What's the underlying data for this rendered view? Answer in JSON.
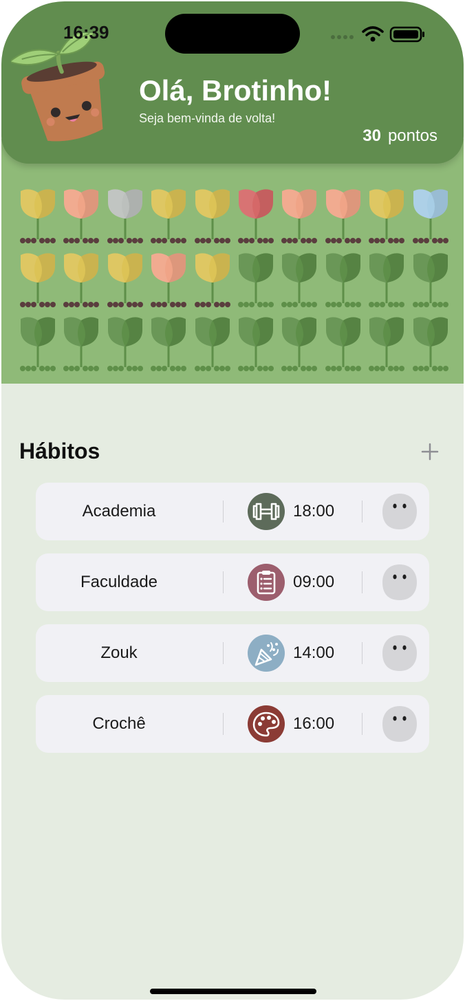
{
  "status_bar": {
    "time": "16:39"
  },
  "header": {
    "greeting": "Olá, Brotinho!",
    "subtitle": "Seja bem-vinda de volta!",
    "points_value": "30",
    "points_label": "pontos"
  },
  "garden": {
    "rows": [
      [
        "#dcc356",
        "#f0a487",
        "#bcc0bd",
        "#dcc356",
        "#dcc356",
        "#d56868",
        "#f0a487",
        "#f0a487",
        "#dcc356",
        "#a7cde5"
      ],
      [
        "#dcc356",
        "#dcc356",
        "#dcc356",
        "#f0a487",
        "#dcc356",
        "leaf",
        "leaf",
        "leaf",
        "leaf",
        "leaf"
      ],
      [
        "leaf",
        "leaf",
        "leaf",
        "leaf",
        "leaf",
        "leaf",
        "leaf",
        "leaf",
        "leaf",
        "leaf"
      ]
    ]
  },
  "habits_section": {
    "title": "Hábitos",
    "add_icon": "plus-icon"
  },
  "habits": [
    {
      "name": "Academia",
      "time": "18:00",
      "icon": "dumbbell-icon",
      "color": "#5d6b5a"
    },
    {
      "name": "Faculdade",
      "time": "09:00",
      "icon": "clipboard-icon",
      "color": "#9c5e6d"
    },
    {
      "name": "Zouk",
      "time": "14:00",
      "icon": "party-popper-icon",
      "color": "#8daec4"
    },
    {
      "name": "Crochê",
      "time": "16:00",
      "icon": "palette-icon",
      "color": "#8b3b35"
    }
  ]
}
